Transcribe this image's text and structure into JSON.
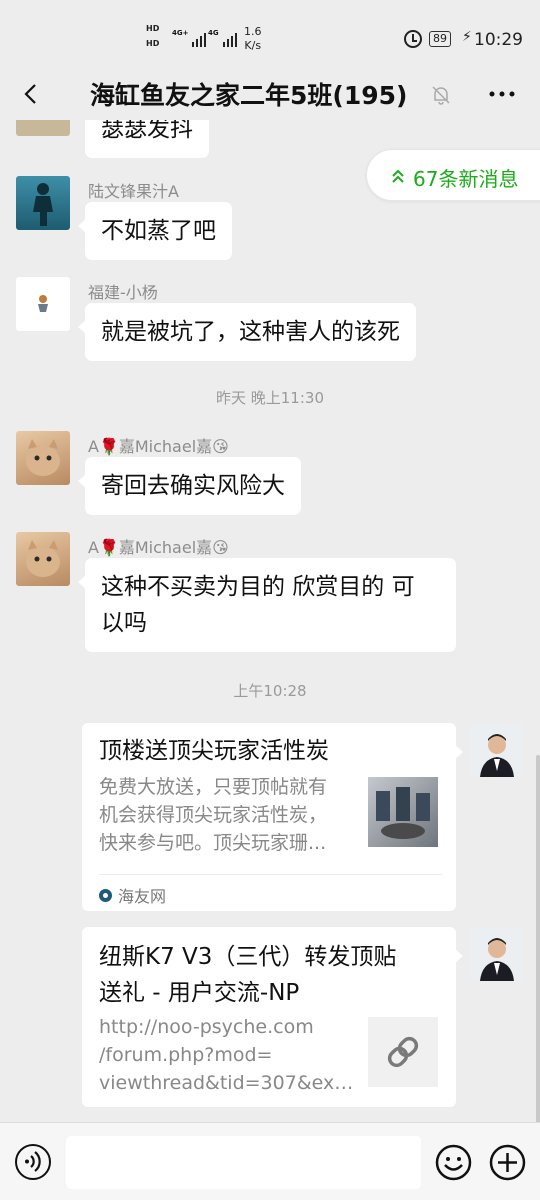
{
  "status_bar": {
    "hd_top": "HD",
    "hd_bottom": "HD",
    "net1": "4G+",
    "net2": "4G",
    "speed_value": "1.6",
    "speed_unit": "K/s",
    "battery": "89",
    "time": "10:29"
  },
  "header": {
    "title": "海缸鱼友之家二年5班(195)"
  },
  "new_messages": {
    "label": "67条新消息"
  },
  "messages": [
    {
      "type": "text",
      "text": "瑟瑟发抖"
    },
    {
      "type": "text",
      "sender": "陆文锋果汁A",
      "text": "不如蒸了吧"
    },
    {
      "type": "text",
      "sender": "福建-小杨",
      "text": "就是被坑了，这种害人的该死"
    },
    {
      "type": "time",
      "text": "昨天 晚上11:30"
    },
    {
      "type": "text",
      "sender": "A🌹嘉Michael嘉😘",
      "text": "寄回去确实风险大"
    },
    {
      "type": "text",
      "sender": "A🌹嘉Michael嘉😘",
      "text_line1": "这种不买卖为目的 欣赏目的 可",
      "text_line2": "以吗"
    },
    {
      "type": "time",
      "text": "上午10:28"
    },
    {
      "type": "card",
      "title": "顶楼送顶尖玩家活性炭",
      "desc_line1": "免费大放送，只要顶帖就有",
      "desc_line2": "机会获得顶尖玩家活性炭，",
      "desc_line3": "快来参与吧。顶尖玩家珊...",
      "source": "海友网"
    },
    {
      "type": "card",
      "title_line1": "纽斯K7 V3（三代）转发顶贴",
      "title_line2": "送礼 - 用户交流-NP",
      "desc_line1": "http://noo-psyche.com",
      "desc_line2": "/forum.php?mod=",
      "desc_line3": "viewthread&tid=307&extr..."
    }
  ],
  "input": {
    "placeholder": ""
  },
  "colors": {
    "accent_green": "#1aad19",
    "bubble": "#ffffff",
    "background": "#ededed"
  }
}
